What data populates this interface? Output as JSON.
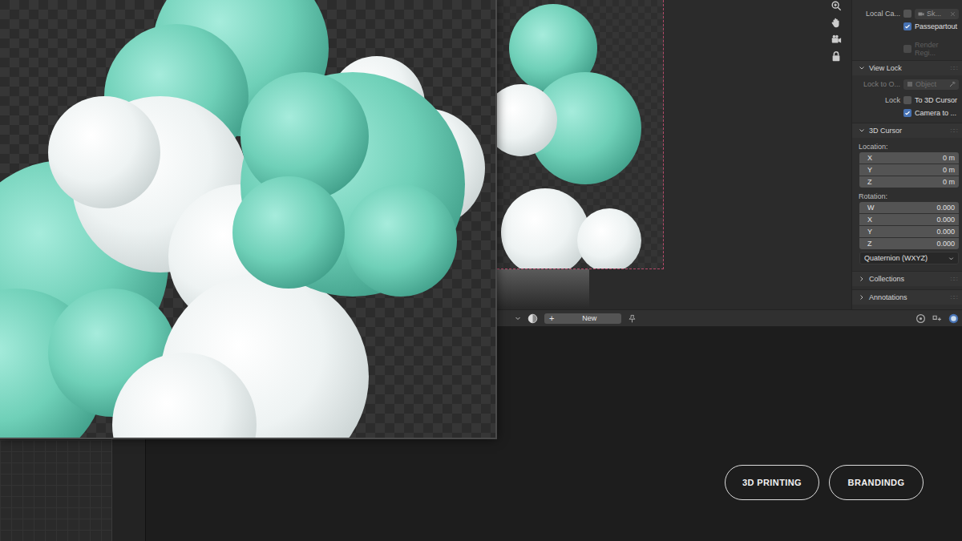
{
  "sidebar": {
    "local_camera": {
      "label": "Local Ca...",
      "checked": false,
      "field": "Sk..."
    },
    "passepartout": {
      "label": "Passepartout",
      "checked": true
    },
    "render_region": {
      "label": "Render Regi...",
      "checked": false,
      "disabled": true
    },
    "view_lock": {
      "title": "View Lock",
      "expanded": true,
      "lock_to_label": "Lock to O...",
      "object_placeholder": "Object",
      "lock_label": "Lock",
      "options": [
        {
          "label": "To 3D Cursor",
          "checked": false
        },
        {
          "label": "Camera to ...",
          "checked": true
        }
      ]
    },
    "cursor": {
      "title": "3D Cursor",
      "expanded": true,
      "location_label": "Location:",
      "location": [
        {
          "axis": "X",
          "value": "0 m"
        },
        {
          "axis": "Y",
          "value": "0 m"
        },
        {
          "axis": "Z",
          "value": "0 m"
        }
      ],
      "rotation_label": "Rotation:",
      "rotation": [
        {
          "axis": "W",
          "value": "0.000"
        },
        {
          "axis": "X",
          "value": "0.000"
        },
        {
          "axis": "Y",
          "value": "0.000"
        },
        {
          "axis": "Z",
          "value": "0.000"
        }
      ],
      "mode": "Quaternion (WXYZ)"
    },
    "panels": [
      {
        "title": "Collections",
        "expanded": false
      },
      {
        "title": "Annotations",
        "expanded": false
      }
    ]
  },
  "header": {
    "plus": "+",
    "new_button": "New"
  },
  "buttons": [
    {
      "label": "3D PRINTING"
    },
    {
      "label": "BRANDINDG"
    }
  ]
}
